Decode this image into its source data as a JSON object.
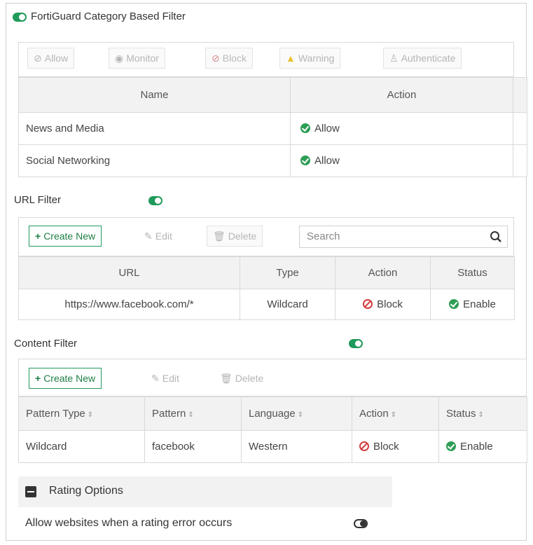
{
  "fortiguard": {
    "title": "FortiGuard Category Based Filter",
    "toolbar": {
      "allow": "Allow",
      "monitor": "Monitor",
      "block": "Block",
      "warning": "Warning",
      "authenticate": "Authenticate"
    },
    "columns": [
      "Name",
      "Action"
    ],
    "rows": [
      {
        "name": "News and Media",
        "action": "Allow"
      },
      {
        "name": "Social Networking",
        "action": "Allow"
      }
    ]
  },
  "url_filter": {
    "title": "URL Filter",
    "toolbar": {
      "create_new": "Create New",
      "edit": "Edit",
      "delete": "Delete",
      "search_placeholder": "Search"
    },
    "columns": [
      "URL",
      "Type",
      "Action",
      "Status"
    ],
    "rows": [
      {
        "url": "https://www.facebook.com/*",
        "type": "Wildcard",
        "action": "Block",
        "status": "Enable"
      }
    ]
  },
  "content_filter": {
    "title": "Content Filter",
    "toolbar": {
      "create_new": "Create New",
      "edit": "Edit",
      "delete": "Delete"
    },
    "columns": [
      "Pattern Type",
      "Pattern",
      "Language",
      "Action",
      "Status"
    ],
    "rows": [
      {
        "pattern_type": "Wildcard",
        "pattern": "facebook",
        "language": "Western",
        "action": "Block",
        "status": "Enable"
      }
    ]
  },
  "rating_options": {
    "title": "Rating Options",
    "allow_on_error_label": "Allow websites when a rating error occurs"
  },
  "colors": {
    "toggle_on": "#1f9a5a",
    "allow_green": "#2e9e55",
    "block_red": "#d43c3c",
    "warning_yellow": "#e8b400"
  },
  "icons": {
    "toggle": "toggle-switch-icon",
    "allow": "check-circle-icon",
    "block": "no-entry-icon",
    "search": "search-icon",
    "edit": "pencil-icon",
    "delete": "trash-icon",
    "add": "plus-icon",
    "collapse": "minus-square-icon"
  }
}
